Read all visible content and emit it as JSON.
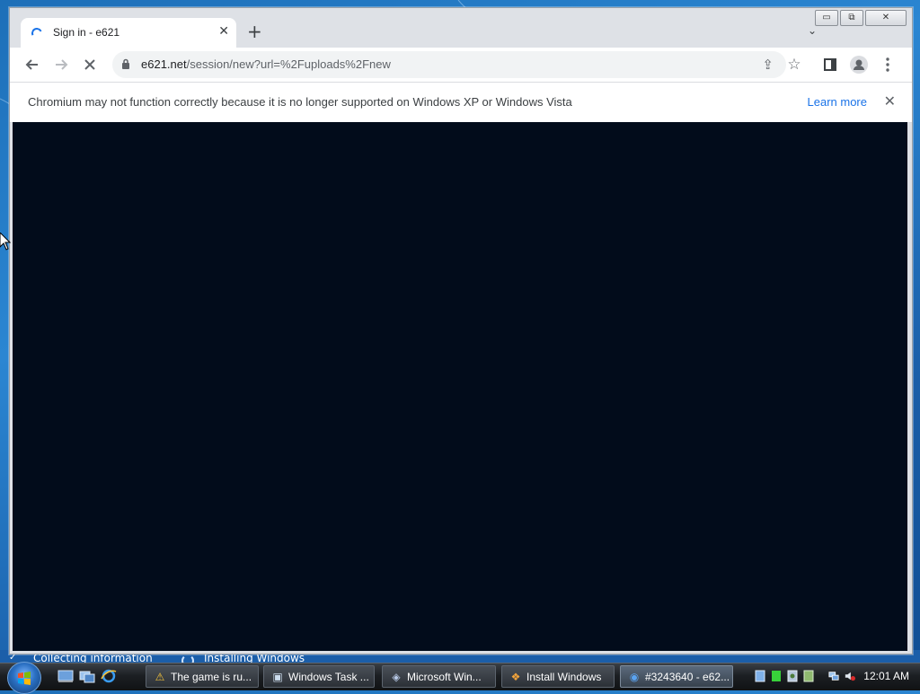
{
  "installer": {
    "step_collecting": "Collecting information",
    "step_installing": "Installing Windows"
  },
  "browser": {
    "tab_title": "Sign in - e621",
    "new_tab_glyph": "+",
    "tab_close_glyph": "✕",
    "tab_search_glyph": "⌄",
    "url_host": "e621.net",
    "url_path": "/session/new?url=%2Fuploads%2Fnew",
    "infobar_message": "Chromium may not function correctly because it is no longer supported on Windows XP or Windows Vista",
    "infobar_link": "Learn more",
    "infobar_close_glyph": "✕",
    "content_background": "#020c1b"
  },
  "caption_buttons": {
    "minimize": "▭",
    "maximize": "⧉",
    "close": "✕"
  },
  "taskbar": {
    "items": [
      {
        "label": "The game is ru...",
        "icon": "warning-icon",
        "glyph": "⚠"
      },
      {
        "label": "Windows Task ...",
        "icon": "task-manager-icon",
        "glyph": "▣"
      },
      {
        "label": "Microsoft Win...",
        "icon": "windows-installer-icon",
        "glyph": "◈"
      },
      {
        "label": "Install Windows",
        "icon": "windows-flag-icon",
        "glyph": "❖"
      },
      {
        "label": "#3243640 - e62...",
        "icon": "chromium-icon",
        "glyph": "◉"
      }
    ],
    "clock": "12:01 AM"
  },
  "colors": {
    "accent": "#1a73e8",
    "taskbar": "#1c1f23",
    "desktop": "#2b86d2"
  }
}
